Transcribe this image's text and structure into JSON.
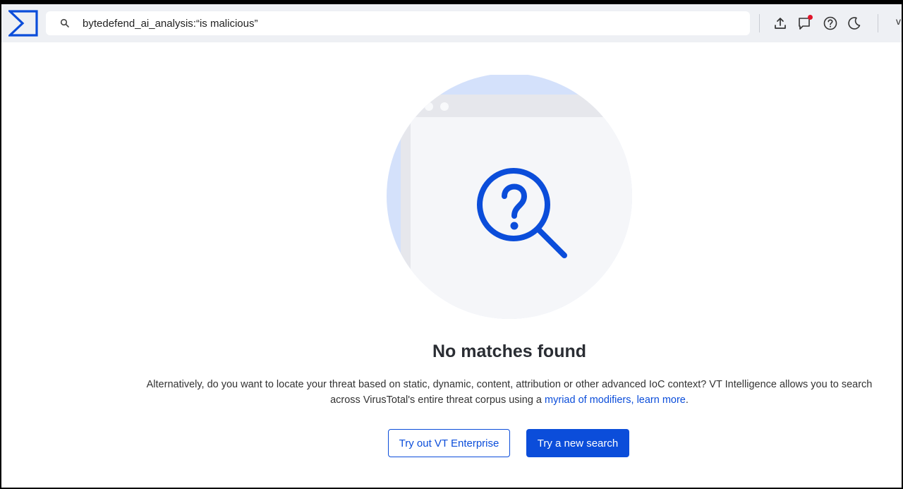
{
  "header": {
    "search": {
      "value": "bytedefend_ai_analysis:“is malicious”",
      "placeholder": ""
    },
    "icons": [
      "upload-icon",
      "chat-notification-icon",
      "help-icon",
      "dark-mode-icon"
    ],
    "edge_glyph": "v"
  },
  "main": {
    "title": "No matches found",
    "description_text": "Alternatively, do you want to locate your threat based on static, dynamic, content, attribution or other advanced IoC context? VT Intelligence allows you to search across VirusTotal's entire threat corpus using a ",
    "description_link": "myriad of modifiers, learn more",
    "description_end": ".",
    "buttons": {
      "enterprise": "Try out VT Enterprise",
      "new_search": "Try a new search"
    }
  },
  "colors": {
    "accent": "#0b4dda",
    "header_bg": "#eef0f4",
    "notification": "#e0142a",
    "illustration_circle": "#f5f6f9",
    "illustration_accent": "#d4e1fb"
  }
}
